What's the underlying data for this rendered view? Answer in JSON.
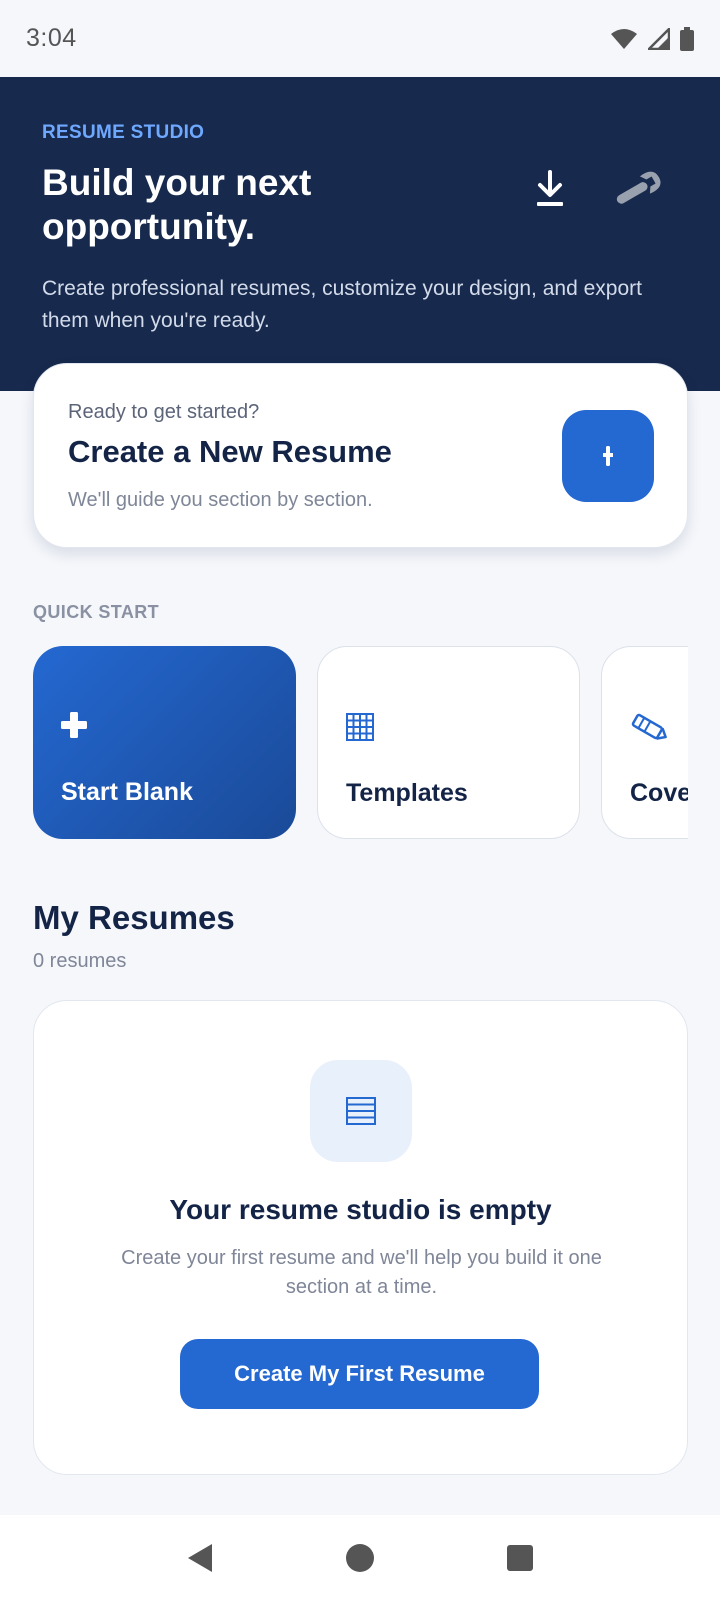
{
  "status_bar": {
    "time": "3:04",
    "icons": [
      "wifi-icon",
      "signal-icon",
      "battery-icon"
    ]
  },
  "hero": {
    "eyebrow": "RESUME STUDIO",
    "title": "Build your next opportunity.",
    "description": "Create professional resumes, customize your design, and export them when you're ready.",
    "actions": [
      "download-icon",
      "wrench-icon"
    ]
  },
  "new_resume_card": {
    "kicker": "Ready to get started?",
    "title": "Create a New Resume",
    "subtitle": "We'll guide you section by section."
  },
  "quick_start": {
    "label": "QUICK START",
    "items": [
      {
        "label": "Start Blank",
        "icon": "plus-icon"
      },
      {
        "label": "Templates",
        "icon": "grid-icon"
      },
      {
        "label": "Cove",
        "icon": "pencil-icon"
      }
    ]
  },
  "my_resumes": {
    "title": "My Resumes",
    "count": "0 resumes",
    "empty": {
      "icon": "document-lines-icon",
      "title": "Your resume studio is empty",
      "description": "Create your first resume and we'll help you build it one section at a time.",
      "button_label": "Create My First Resume"
    }
  },
  "nav_bar": {
    "buttons": [
      "back-icon",
      "home-icon",
      "recents-icon"
    ]
  },
  "colors": {
    "primary": "#2468D1",
    "hero_background": "#17294D",
    "accent_text": "#6FA8FF",
    "page_background": "#F5F7FB"
  }
}
